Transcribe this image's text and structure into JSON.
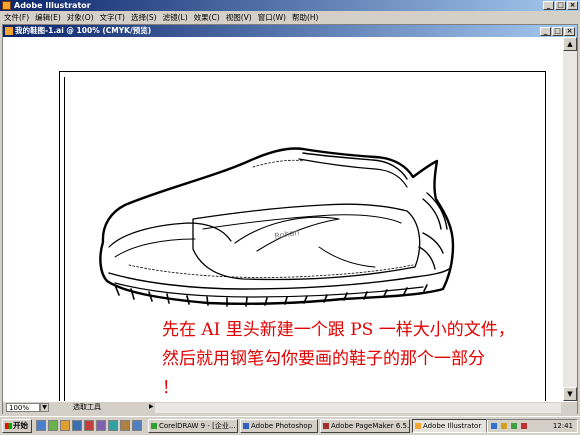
{
  "window": {
    "title": "Adobe Illustrator"
  },
  "menu": [
    "文件(F)",
    "编辑(E)",
    "对象(O)",
    "文字(T)",
    "选择(S)",
    "滤镜(L)",
    "效果(C)",
    "视图(V)",
    "窗口(W)",
    "帮助(H)"
  ],
  "document": {
    "title": "我的鞋图-1.ai @ 100% (CMYK/预览)"
  },
  "status": {
    "zoom": "100%",
    "tool": "选取工具"
  },
  "taskbar": {
    "start": "开始",
    "tasks": [
      "CorelDRAW 9 - [企业...",
      "Adobe Photoshop",
      "Adobe PageMaker 6.5...",
      "Adobe Illustrator"
    ],
    "clock": "12:41"
  },
  "annotation": {
    "line1": "先在 AI 里头新建一个跟 PS 一样大小的文件，",
    "line2": "然后就用钢笔勾你要画的鞋子的那个一部分",
    "line3": "！",
    "color": "#e00000"
  },
  "colors": {
    "titlebar": "#0a246a",
    "chrome": "#d4d0c8"
  }
}
